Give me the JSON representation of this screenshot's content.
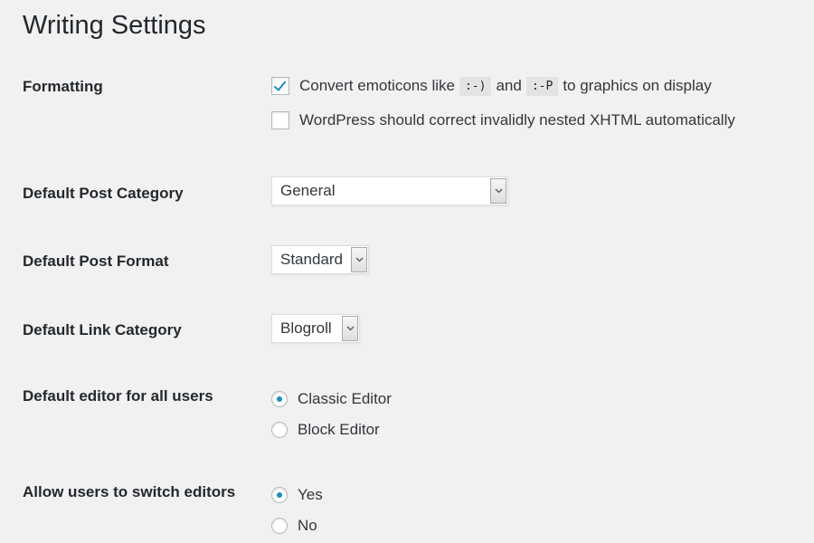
{
  "page": {
    "title": "Writing Settings"
  },
  "formatting": {
    "label": "Formatting",
    "emoticons": {
      "checked": true,
      "text_before": "Convert emoticons like",
      "code1": ":-)",
      "text_middle": "and",
      "code2": ":-P",
      "text_after": "to graphics on display"
    },
    "xhtml": {
      "checked": false,
      "text": "WordPress should correct invalidly nested XHTML automatically"
    }
  },
  "default_post_category": {
    "label": "Default Post Category",
    "value": "General"
  },
  "default_post_format": {
    "label": "Default Post Format",
    "value": "Standard"
  },
  "default_link_category": {
    "label": "Default Link Category",
    "value": "Blogroll"
  },
  "default_editor": {
    "label": "Default editor for all users",
    "options": [
      {
        "label": "Classic Editor",
        "selected": true
      },
      {
        "label": "Block Editor",
        "selected": false
      }
    ]
  },
  "allow_switch": {
    "label": "Allow users to switch editors",
    "options": [
      {
        "label": "Yes",
        "selected": true
      },
      {
        "label": "No",
        "selected": false
      }
    ]
  },
  "icons": {
    "checkbox_checked": "checkmark-icon",
    "select_arrow": "chevron-down-icon"
  },
  "colors": {
    "background": "#f1f1f1",
    "text": "#23282d",
    "accent": "#1e8cbe"
  }
}
